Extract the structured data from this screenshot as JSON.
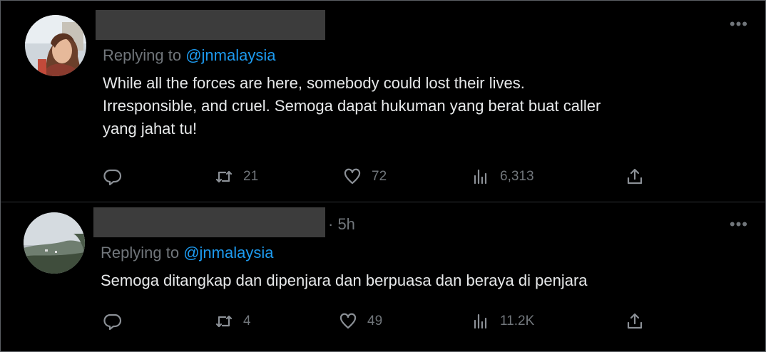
{
  "tweets": [
    {
      "time": "",
      "replying_prefix": "Replying to ",
      "replying_handle": "@jnmalaysia",
      "text": "While all the forces are here, somebody could lost their lives.\nIrresponsible, and cruel. Semoga dapat hukuman yang berat buat caller\nyang jahat tu!",
      "more": "•••",
      "stats": {
        "replies": "",
        "retweets": "21",
        "likes": "72",
        "views": "6,313"
      }
    },
    {
      "time": "· 5h",
      "replying_prefix": "Replying to ",
      "replying_handle": "@jnmalaysia",
      "text": "Semoga ditangkap dan dipenjara dan berpuasa dan beraya  di penjara",
      "more": "•••",
      "stats": {
        "replies": "",
        "retweets": "4",
        "likes": "49",
        "views": "11.2K"
      }
    }
  ],
  "icons": [
    "reply-icon",
    "retweet-icon",
    "like-icon",
    "views-icon",
    "share-icon",
    "more-icon"
  ],
  "colors": {
    "background": "#000000",
    "text": "#e7e9ea",
    "muted": "#71767b",
    "link": "#1d9bf0",
    "redaction": "#3c3c3c"
  }
}
